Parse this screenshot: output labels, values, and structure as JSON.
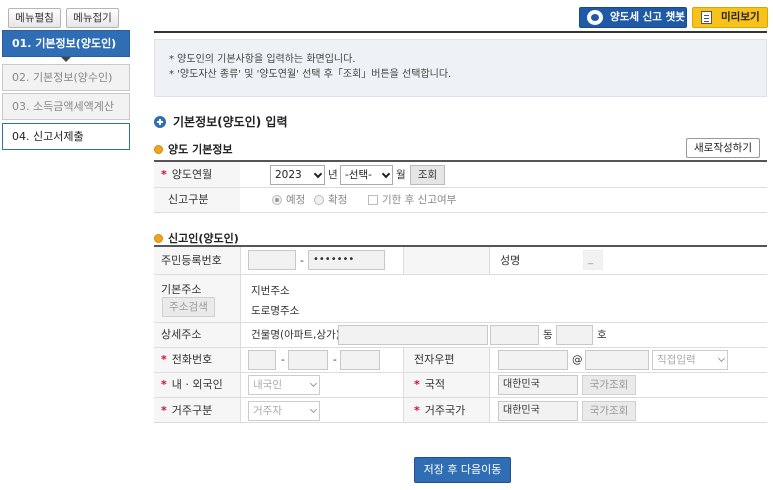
{
  "sidebar": {
    "menu_edit": "메뉴펼침",
    "menu_collapse": "메뉴접기",
    "steps": [
      {
        "label": "01. 기본정보(양도인)"
      },
      {
        "label": "02. 기본정보(양수인)"
      },
      {
        "label": "03. 소득금액세액계산"
      },
      {
        "label": "04. 신고서제출"
      }
    ]
  },
  "header": {
    "chatbot_label": "양도세 신고 챗봇",
    "preview_label": "미리보기"
  },
  "notice": {
    "line1": "* 양도인의 기본사항을 입력하는 화면입니다.",
    "line2": "* '양도자산 종류' 및 '양도연월' 선택 후「조회」버튼을 선택합니다."
  },
  "section_title": "기본정보(양도인) 입력",
  "transfer": {
    "title": "양도 기본정보",
    "renew_label": "새로작성하기",
    "period_label": "양도연월",
    "year_value": "2023",
    "year_unit": "년",
    "month_value": "-선택-",
    "month_unit": "월",
    "search_label": "조회",
    "report_type_label": "신고구분",
    "radio_planned": "예정",
    "radio_final": "확정",
    "late_check": "기한 후 신고여부"
  },
  "reporter": {
    "title": "신고인(양도인)",
    "rrn_label": "주민등록번호",
    "rrn_dash": "-",
    "rrn_back_masked": "•••••••",
    "name_label": "성명",
    "name_value": "_",
    "addr_label": "기본주소",
    "addr_search": "주소검색",
    "lot_addr": "지번주소",
    "road_addr": "도로명주소",
    "detail_label": "상세주소",
    "bldg_label": "건물명(아파트,상가)",
    "dong": "동",
    "ho": "호",
    "phone_label": "전화번호",
    "phone_dash": "-",
    "email_label": "전자우편",
    "at": "@",
    "email_domain_select": "직접입력",
    "nationality_label": "내 · 외국인",
    "nationality_value": "내국인",
    "country_label": "국적",
    "country_value": "대한민국",
    "country_lookup": "국가조회",
    "residence_label": "거주구분",
    "residence_value": "거주자",
    "res_country_label": "거주국가",
    "res_country_value": "대한민국",
    "res_country_lookup": "국가조회"
  },
  "footer": {
    "save_next": "저장 후 다음이동"
  },
  "colors": {
    "primary": "#2f6db5",
    "accent": "#f7c21a",
    "required": "#d0102a"
  }
}
